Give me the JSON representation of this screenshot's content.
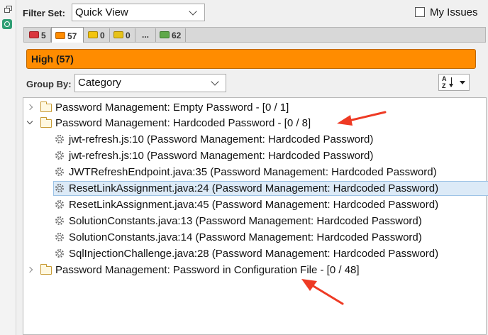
{
  "filter": {
    "label": "Filter Set:",
    "selected": "Quick View"
  },
  "my_issues": {
    "label": "My Issues",
    "checked": false
  },
  "tabs": [
    {
      "count": "5",
      "color": "#d9363e",
      "selected": false
    },
    {
      "count": "57",
      "color": "#ff8c00",
      "selected": true
    },
    {
      "count": "0",
      "color": "#f2c40f",
      "selected": false
    },
    {
      "count": "0",
      "color": "#e6c21a",
      "selected": false
    },
    {
      "count": "...",
      "selected": false
    },
    {
      "count": "62",
      "color": "#5fa84a",
      "selected": false
    }
  ],
  "priority_bar": {
    "label": "High (57)",
    "color": "#ff8c00"
  },
  "group_by": {
    "label": "Group By:",
    "selected": "Category"
  },
  "sort": {
    "glyph_top": "A",
    "glyph_bottom": "Z"
  },
  "tree": {
    "groups": [
      {
        "label": "Password Management: Empty Password - [0 / 1]",
        "expanded": false
      },
      {
        "label": "Password Management: Hardcoded Password - [0 / 8]",
        "expanded": true,
        "issues": [
          {
            "label": "jwt-refresh.js:10 (Password Management: Hardcoded Password)"
          },
          {
            "label": "jwt-refresh.js:10 (Password Management: Hardcoded Password)"
          },
          {
            "label": "JWTRefreshEndpoint.java:35 (Password Management: Hardcoded Password)"
          },
          {
            "label": "ResetLinkAssignment.java:24 (Password Management: Hardcoded Password)",
            "selected": true
          },
          {
            "label": "ResetLinkAssignment.java:45 (Password Management: Hardcoded Password)"
          },
          {
            "label": "SolutionConstants.java:13 (Password Management: Hardcoded Password)"
          },
          {
            "label": "SolutionConstants.java:14 (Password Management: Hardcoded Password)"
          },
          {
            "label": "SqlInjectionChallenge.java:28 (Password Management: Hardcoded Password)"
          }
        ]
      },
      {
        "label": "Password Management: Password in Configuration File - [0 / 48]",
        "expanded": false
      }
    ]
  },
  "annotations": {
    "arrow_color": "#ee3a24"
  }
}
